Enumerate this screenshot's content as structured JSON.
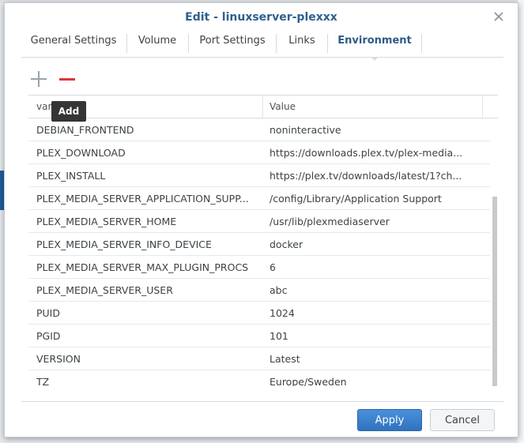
{
  "dialog": {
    "title": "Edit - linuxserver-plexxx"
  },
  "tabs": [
    {
      "label": "General Settings"
    },
    {
      "label": "Volume"
    },
    {
      "label": "Port Settings"
    },
    {
      "label": "Links"
    },
    {
      "label": "Environment",
      "active": true
    }
  ],
  "toolbar": {
    "add_tooltip": "Add",
    "add_icon": "plus-icon",
    "delete_icon": "minus-icon"
  },
  "table": {
    "columns": {
      "variable": "vari",
      "value": "Value"
    },
    "rows": [
      {
        "key": "DEBIAN_FRONTEND",
        "value": "noninteractive"
      },
      {
        "key": "PLEX_DOWNLOAD",
        "value": "https://downloads.plex.tv/plex-media..."
      },
      {
        "key": "PLEX_INSTALL",
        "value": "https://plex.tv/downloads/latest/1?ch..."
      },
      {
        "key": "PLEX_MEDIA_SERVER_APPLICATION_SUPP...",
        "value": "/config/Library/Application Support"
      },
      {
        "key": "PLEX_MEDIA_SERVER_HOME",
        "value": "/usr/lib/plexmediaserver"
      },
      {
        "key": "PLEX_MEDIA_SERVER_INFO_DEVICE",
        "value": "docker"
      },
      {
        "key": "PLEX_MEDIA_SERVER_MAX_PLUGIN_PROCS",
        "value": "6"
      },
      {
        "key": "PLEX_MEDIA_SERVER_USER",
        "value": "abc"
      },
      {
        "key": "PUID",
        "value": "1024"
      },
      {
        "key": "PGID",
        "value": "101"
      },
      {
        "key": "VERSION",
        "value": "Latest"
      },
      {
        "key": "TZ",
        "value": "Europe/Sweden"
      }
    ]
  },
  "footer": {
    "apply_label": "Apply",
    "cancel_label": "Cancel"
  },
  "colors": {
    "accent": "#2f73c0",
    "title": "#2f5f8f",
    "delete": "#e0353a"
  }
}
